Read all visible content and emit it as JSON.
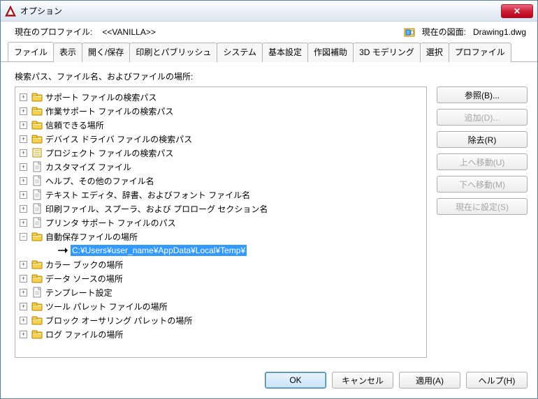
{
  "window": {
    "title": "オプション",
    "close_label": "✕"
  },
  "header": {
    "profile_label": "現在のプロファイル:",
    "profile_value": "<<VANILLA>>",
    "drawing_label": "現在の図面:",
    "drawing_value": "Drawing1.dwg"
  },
  "tabs": [
    {
      "label": "ファイル",
      "active": true
    },
    {
      "label": "表示"
    },
    {
      "label": "開く/保存"
    },
    {
      "label": "印刷とパブリッシュ"
    },
    {
      "label": "システム"
    },
    {
      "label": "基本設定"
    },
    {
      "label": "作図補助"
    },
    {
      "label": "3D モデリング"
    },
    {
      "label": "選択"
    },
    {
      "label": "プロファイル"
    }
  ],
  "content": {
    "section_label": "検索パス、ファイル名、およびファイルの場所:"
  },
  "tree": [
    {
      "icon": "folder",
      "label": "サポート ファイルの検索パス",
      "toggle": "+"
    },
    {
      "icon": "folder",
      "label": "作業サポート ファイルの検索パス",
      "toggle": "+"
    },
    {
      "icon": "folder",
      "label": "信頼できる場所",
      "toggle": "+"
    },
    {
      "icon": "folder",
      "label": "デバイス ドライバ ファイルの検索パス",
      "toggle": "+"
    },
    {
      "icon": "sheet",
      "label": "プロジェクト ファイルの検索パス",
      "toggle": "+"
    },
    {
      "icon": "file",
      "label": "カスタマイズ ファイル",
      "toggle": "+"
    },
    {
      "icon": "file",
      "label": "ヘルプ、その他のファイル名",
      "toggle": "+"
    },
    {
      "icon": "file",
      "label": "テキスト エディタ、辞書、およびフォント ファイル名",
      "toggle": "+"
    },
    {
      "icon": "file",
      "label": "印刷ファイル、スプーラ、および プロローグ セクション名",
      "toggle": "+"
    },
    {
      "icon": "file",
      "label": "プリンタ サポート ファイルのパス",
      "toggle": "+"
    },
    {
      "icon": "folder",
      "label": "自動保存ファイルの場所",
      "toggle": "-",
      "expanded": true,
      "children": [
        {
          "icon": "arrow",
          "label": "C:¥Users¥user_name¥AppData¥Local¥Temp¥",
          "selected": true
        }
      ]
    },
    {
      "icon": "folder",
      "label": "カラー ブックの場所",
      "toggle": "+"
    },
    {
      "icon": "folder",
      "label": "データ ソースの場所",
      "toggle": "+"
    },
    {
      "icon": "file",
      "label": "テンプレート設定",
      "toggle": "+"
    },
    {
      "icon": "folder",
      "label": "ツール パレット ファイルの場所",
      "toggle": "+"
    },
    {
      "icon": "folder",
      "label": "ブロック オーサリング パレットの場所",
      "toggle": "+"
    },
    {
      "icon": "folder",
      "label": "ログ ファイルの場所",
      "toggle": "+"
    }
  ],
  "side_buttons": {
    "browse": "参照(B)...",
    "add": "追加(D)...",
    "remove": "除去(R)",
    "move_up": "上へ移動(U)",
    "move_down": "下へ移動(M)",
    "set_current": "現在に設定(S)"
  },
  "footer": {
    "ok": "OK",
    "cancel": "キャンセル",
    "apply": "適用(A)",
    "help": "ヘルプ(H)"
  }
}
